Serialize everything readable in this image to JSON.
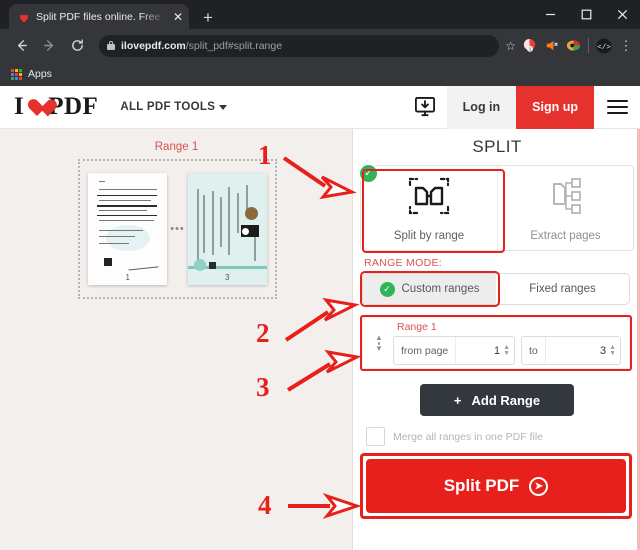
{
  "browser": {
    "tab": {
      "title": "Split PDF files online. Free service",
      "favicon_name": "heart-favicon",
      "close_label": "✕"
    },
    "newtab_label": "+",
    "window_controls": {
      "minimize": "—",
      "maximize": "□",
      "close": "✕"
    },
    "nav": {
      "back": "←",
      "forward": "→",
      "reload": "⟳"
    },
    "omnibox": {
      "url_host": "ilovepdf.com",
      "url_path": "/split_pdf#split.range",
      "full_url": "ilovepdf.com/split_pdf#split.range",
      "star": "☆"
    },
    "extensions": [
      "pocket-extension-icon",
      "speaker-extension-icon",
      "palette-extension-icon"
    ],
    "menu_label": "⋮",
    "bookmarks": {
      "apps_label": "Apps"
    }
  },
  "site": {
    "logo": {
      "pre": "I",
      "post": "PDF",
      "heart_name": "heart-logo-icon"
    },
    "nav": {
      "all_tools": "ALL PDF TOOLS"
    },
    "header_actions": {
      "desktop_icon": "desktop-download-icon",
      "login": "Log in",
      "signup": "Sign up",
      "menu": "hamburger-menu-icon"
    }
  },
  "preview": {
    "range_caption": "Range 1",
    "dots": "•••",
    "thumbnails": [
      {
        "page_number": "1",
        "kind": "text-document"
      },
      {
        "page_number": "3",
        "kind": "certificate-document"
      }
    ]
  },
  "panel": {
    "title": "SPLIT",
    "modes": [
      {
        "label": "Split by range",
        "icon": "split-by-range-icon",
        "selected": true
      },
      {
        "label": "Extract pages",
        "icon": "extract-pages-icon",
        "selected": false
      }
    ],
    "range_mode_label": "RANGE MODE:",
    "range_mode_options": [
      {
        "label": "Custom ranges",
        "selected": true
      },
      {
        "label": "Fixed ranges",
        "selected": false
      }
    ],
    "range": {
      "title": "Range 1",
      "from_label": "from page",
      "from_value": "1",
      "to_label": "to",
      "to_value": "3"
    },
    "add_range_label": "Add Range",
    "add_range_plus": "+",
    "merge_label": "Merge all ranges in one PDF file",
    "merge_checked": false,
    "split_button_label": "Split PDF",
    "split_button_arrow": "➜"
  },
  "annotations": [
    {
      "number": "1",
      "target": "split-by-range-card"
    },
    {
      "number": "2",
      "target": "custom-ranges-toggle"
    },
    {
      "number": "3",
      "target": "range-1-inputs"
    },
    {
      "number": "4",
      "target": "split-pdf-button"
    }
  ],
  "colors": {
    "brand_red": "#e5322d",
    "annotation_red": "#e8201c",
    "dark_button": "#33383f",
    "check_green": "#2fb457",
    "chrome_dark": "#202124",
    "chrome_toolbar": "#35363a",
    "left_pane_bg": "#f2efed"
  }
}
